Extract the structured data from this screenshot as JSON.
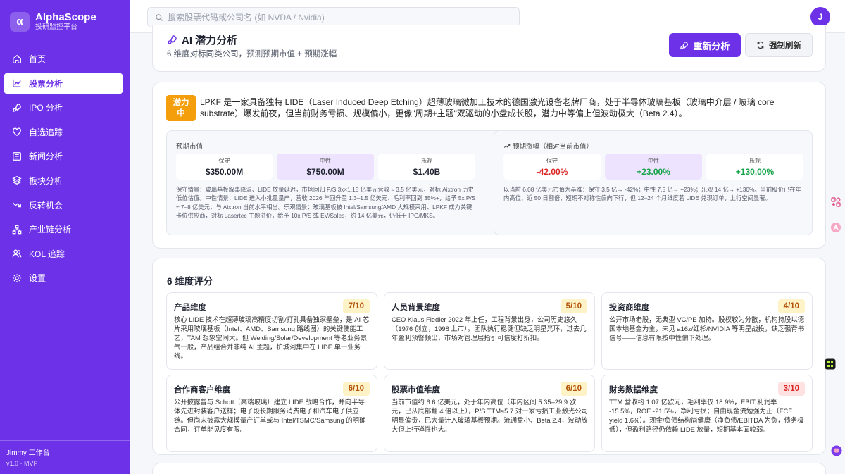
{
  "brand": {
    "logo_letter": "α",
    "name": "AlphaScope",
    "subtitle": "投研监控平台"
  },
  "nav": {
    "items": [
      {
        "label": "首页",
        "icon": "home-icon",
        "active": false
      },
      {
        "label": "股票分析",
        "icon": "chart-line-icon",
        "active": true
      },
      {
        "label": "IPO 分析",
        "icon": "rocket-icon",
        "active": false
      },
      {
        "label": "自选追踪",
        "icon": "heart-icon",
        "active": false
      },
      {
        "label": "新闻分析",
        "icon": "newspaper-icon",
        "active": false
      },
      {
        "label": "板块分析",
        "icon": "layers-icon",
        "active": false
      },
      {
        "label": "反转机会",
        "icon": "trend-icon",
        "active": false
      },
      {
        "label": "产业链分析",
        "icon": "network-icon",
        "active": false
      },
      {
        "label": "KOL 追踪",
        "icon": "users-icon",
        "active": false
      },
      {
        "label": "设置",
        "icon": "gear-icon",
        "active": false
      }
    ]
  },
  "footer": {
    "user": "Jimmy 工作台",
    "version": "v1.0 · MVP"
  },
  "search": {
    "placeholder": "搜索股票代码或公司名 (如 NVDA / Nvidia)"
  },
  "avatar": {
    "letter": "J"
  },
  "header": {
    "title": "AI 潜力分析",
    "subtitle": "6 维度对标同类公司，预测预期市值 + 预期涨幅",
    "reanalyze_label": "重新分析",
    "refresh_label": "强制刷新"
  },
  "summary": {
    "badge": "潜力中",
    "text": "LPKF 是一家具备独特 LIDE（Laser Induced Deep Etching）超薄玻璃微加工技术的德国激光设备老牌厂商，处于半导体玻璃基板（玻璃中介层 / 玻璃 core substrate）爆发前夜，但当前财务亏损、规模偏小，更像\"周期+主题\"双驱动的小盘成长股，潜力中等偏上但波动极大（Beta 2.4）。",
    "market_cap": {
      "title": "预期市值",
      "tiles": [
        {
          "label": "保守",
          "value": "$350.00M"
        },
        {
          "label": "中性",
          "value": "$750.00M"
        },
        {
          "label": "乐观",
          "value": "$1.40B"
        }
      ],
      "note": "保守情景：玻璃基板叙事降温、LIDE 放量延迟，市场回归 P/S 3x×1.15 亿美元营收 ≈ 3.5 亿美元，对标 Aixtron 历史低位估值。中性情景：LIDE 进入小批量量产，营收 2026 年回升至 1.3–1.5 亿美元、毛利率回到 35%+，给予 5x P/S ≈ 7–8 亿美元，与 Aixtron 当前水平相当。乐观情景：玻璃基板被 Intel/Samsung/AMD 大规模采用、LPKF 成为关键卡位供应商，对标 Lasertec 主题溢价，给予 10x P/S 或 EV/Sales，约 14 亿美元，仍低于 IPG/MKS。"
    },
    "upside": {
      "title": "预期涨幅（相对当前市值）",
      "tiles": [
        {
          "label": "保守",
          "value": "-42.00%",
          "tone": "red"
        },
        {
          "label": "中性",
          "value": "+23.00%",
          "tone": "green"
        },
        {
          "label": "乐观",
          "value": "+130.00%",
          "tone": "green"
        }
      ],
      "note": "以当前 6.08 亿美元市值为基准：保守 3.5 亿→ -42%；中性 7.5 亿→ +23%；乐观 14 亿→ +130%。当前股价已在年内高位、近 50 日翻倍，短期不对称性偏向下行，但 12–24 个月维度若 LIDE 兑现订单，上行空间显著。"
    }
  },
  "dimensions": {
    "title": "6 维度评分",
    "items": [
      {
        "name": "产品维度",
        "score": "7/10",
        "tone": "yellow",
        "text": "核心 LIDE 技术在超薄玻璃高精度切割/打孔具备独家壁垒，是 AI 芯片采用玻璃基板（Intel、AMD、Samsung 路线图）的关键使能工艺，TAM 想象空间大。但 Welding/Solar/Development 等老业务景气一般，产品组合并非纯 AI 主题，护城河集中在 LIDE 单一业务线。"
      },
      {
        "name": "人员背景维度",
        "score": "5/10",
        "tone": "yellow",
        "text": "CEO Klaus Fiedler 2022 年上任，工程背景出身，公司历史悠久（1976 创立，1998 上市）。团队执行稳健但缺乏明星光环，过去几年盈利预警频出，市场对管理层指引可信度打折扣。"
      },
      {
        "name": "投资商维度",
        "score": "4/10",
        "tone": "yellow",
        "text": "公开市场老股，无典型 VC/PE 加持。股权较为分散，机构持股以德国本地基金为主，未见 a16z/红杉/NVIDIA 等明星战投，缺乏强背书信号——信息有限按中性偏下处理。"
      },
      {
        "name": "合作商客户维度",
        "score": "6/10",
        "tone": "yellow",
        "text": "公开披露曾与 Schott（高端玻璃）建立 LIDE 战略合作，并向半导体先进封装客户送样；电子段长期服务消费电子和汽车电子供应链。但尚未披露大规模量产订单或与 Intel/TSMC/Samsung 的明确合同，订单能见度有限。"
      },
      {
        "name": "股票市值维度",
        "score": "6/10",
        "tone": "yellow",
        "text": "当前市值约 6.6 亿美元，处于年内高位（年内区间 5.35–29.9 欧元，已从底部翻 4 倍以上），P/S TTM≈5.7 对一家亏损工业激光公司明显偏贵，已大量计入玻璃基板预期。流通盘小、Beta 2.4，波动放大但上行弹性也大。"
      },
      {
        "name": "财务数据维度",
        "score": "3/10",
        "tone": "red",
        "text": "TTM 营收约 1.07 亿欧元，毛利率仅 18.9%，EBIT 利润率 -15.5%，ROE -21.5%，净利亏损；自由现金流勉强为正（FCF yield 1.6%）。现金/负债结构尚健康（净负债/EBITDA 为负，债务极低），但盈利路径仍依赖 LIDE 放量，短期基本面较弱。"
      }
    ]
  },
  "colors": {
    "accent": "#6d32e8",
    "negative": "#dc2626",
    "positive": "#16a34a",
    "warning": "#f59e0b"
  }
}
